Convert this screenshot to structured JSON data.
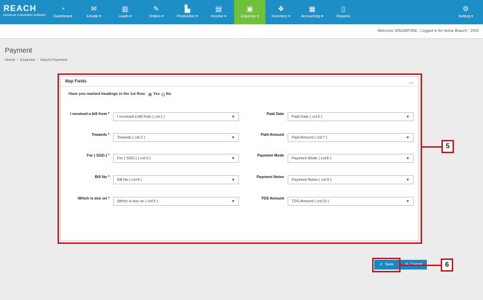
{
  "brand": {
    "logo": "REACH",
    "tagline": "Business Automation Software"
  },
  "nav": [
    {
      "label": "Dashboard",
      "icon": "dashboard-icon",
      "glyph": "◔"
    },
    {
      "label": "Emails ▾",
      "icon": "envelope-icon",
      "glyph": "✉"
    },
    {
      "label": "Leads ▾",
      "icon": "leads-icon",
      "glyph": "▥"
    },
    {
      "label": "Orders ▾",
      "icon": "wrench-icon",
      "glyph": "✎"
    },
    {
      "label": "Production ▾",
      "icon": "production-icon",
      "glyph": "▙"
    },
    {
      "label": "Income ▾",
      "icon": "income-icon",
      "glyph": "▤"
    },
    {
      "label": "Expense ▾",
      "icon": "expense-icon",
      "glyph": "▣"
    },
    {
      "label": "Inventory ▾",
      "icon": "inventory-icon",
      "glyph": "❖"
    },
    {
      "label": "Accounting ▾",
      "icon": "calculator-icon",
      "glyph": "▦"
    },
    {
      "label": "Reports",
      "icon": "reports-icon",
      "glyph": "▯"
    }
  ],
  "settings": {
    "label": "Setting ▾",
    "icon": "gear-icon",
    "glyph": "⚙"
  },
  "welcome": "Welcome SINGAPORE , Logged in for Home Branch - 2016",
  "page": {
    "title": "Payment",
    "breadcrumb": [
      "Home",
      "Expense",
      "Import Payment"
    ]
  },
  "panel": {
    "title": "Map Fields",
    "question": "Have you marked headings in the 1st Row",
    "yes": "Yes",
    "no": "No"
  },
  "left_fields": [
    {
      "label": "I received a bill from *",
      "value": "I received a bill from ( col:1 )"
    },
    {
      "label": "Towards *",
      "value": "Towards ( col:2 )"
    },
    {
      "label": "For ( SGD.) *",
      "value": "For ( SGD.) ( col:3 )"
    },
    {
      "label": "Bill No *",
      "value": "Bill No ( col:4 )"
    },
    {
      "label": "Which is due on *",
      "value": "Which is due on ( col:5 )"
    }
  ],
  "right_fields": [
    {
      "label": "Paid Date",
      "value": "Paid Date ( col:6 )"
    },
    {
      "label": "Paid Amount",
      "value": "Paid Amount ( col:7 )"
    },
    {
      "label": "Payment Mode",
      "value": "Payment Mode ( col:8 )"
    },
    {
      "label": "Payment Notes",
      "value": "Payment Notes ( col:9 )"
    },
    {
      "label": "TDS Amount",
      "value": "TDS Amount ( col:10 )"
    }
  ],
  "buttons": {
    "save": "Save",
    "cancel": "Cancel"
  },
  "callouts": {
    "fields": "5",
    "save": "6"
  },
  "colors": {
    "nav": "#1e8fc6",
    "active": "#6fc13b",
    "highlight": "#d0121b"
  }
}
